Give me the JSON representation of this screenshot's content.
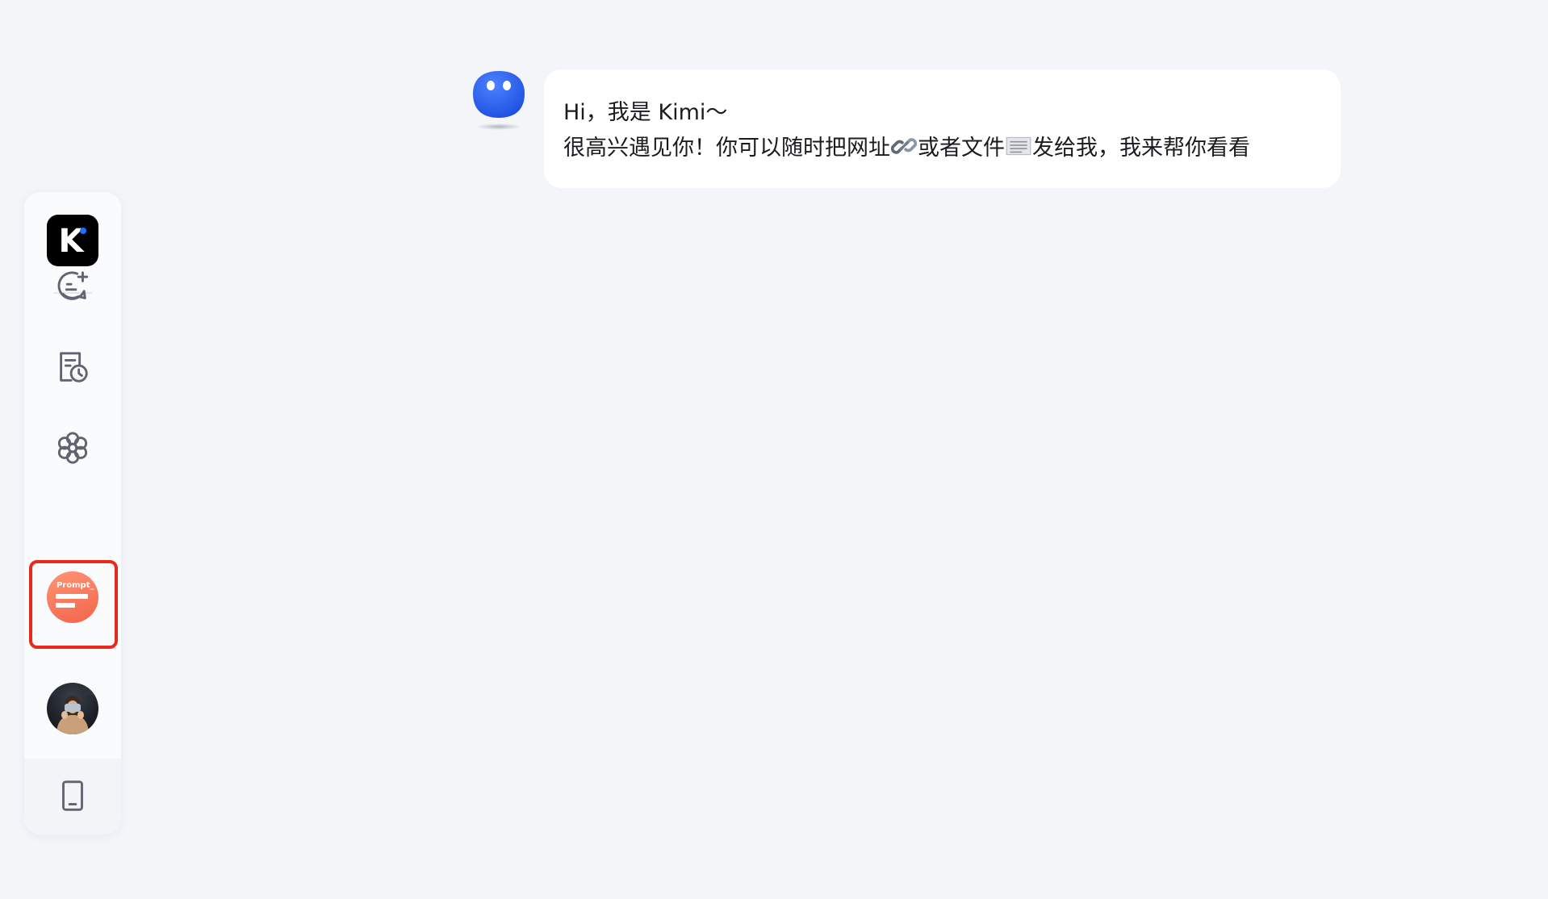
{
  "sidebar": {
    "logo": {
      "letter": "K",
      "dot_color": "#1a73ff"
    },
    "nav": [
      {
        "name": "new-chat",
        "icon": "chat-plus-icon"
      },
      {
        "name": "history",
        "icon": "document-clock-icon"
      },
      {
        "name": "explore",
        "icon": "flower-icon"
      }
    ],
    "prompt_button": {
      "label": "Prompt_",
      "highlight_color": "#e8291c"
    },
    "avatar": {
      "icon": "user-avatar"
    },
    "device": {
      "icon": "tablet-icon"
    }
  },
  "chat": {
    "messages": [
      {
        "sender": "Kimi",
        "line1": "Hi，我是 Kimi～",
        "line2_part1": "很高兴遇见你！你可以随时把网址",
        "line2_emoji1": "link-emoji",
        "line2_part2": "或者文件",
        "line2_emoji2": "document-emoji",
        "line2_part3": "发给我，我来帮你看看"
      }
    ]
  },
  "colors": {
    "background": "#f3f5f9",
    "bot_blue": "#2a63f0",
    "icon_gray": "#5f6470",
    "prompt_orange": "#f26e52"
  }
}
